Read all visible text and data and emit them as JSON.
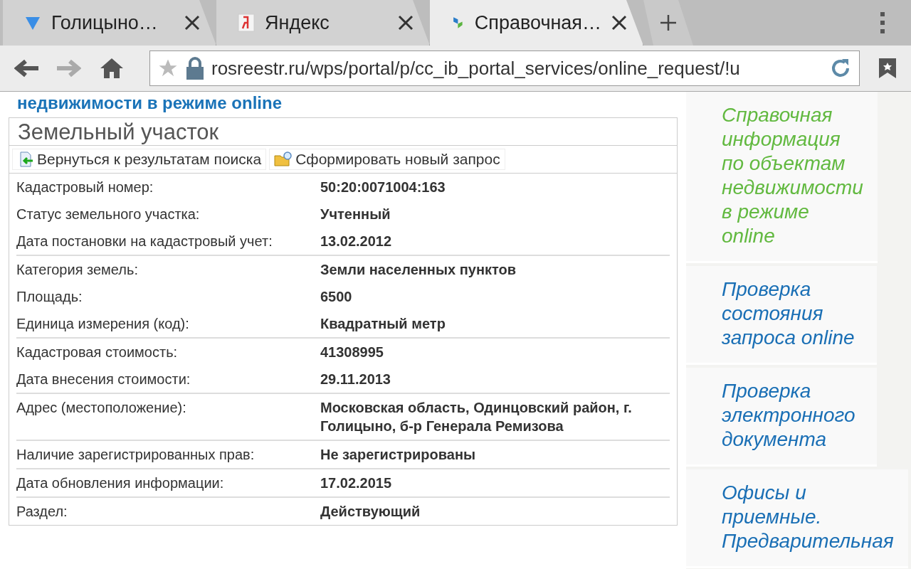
{
  "tabs": [
    {
      "title": "Голицыно…",
      "kind": "check",
      "selected": false
    },
    {
      "title": "Яндекс",
      "kind": "yandex",
      "selected": false
    },
    {
      "title": "Справочная…",
      "kind": "rosreestr",
      "selected": true
    }
  ],
  "address_bar": {
    "url": "rosreestr.ru/wps/portal/p/cc_ib_portal_services/online_request/!u"
  },
  "page_heading": "недвижимости в режиме online",
  "card": {
    "title": "Земельный участок",
    "actions": [
      {
        "label": "Вернуться к результатам поиска",
        "kind": "back"
      },
      {
        "label": "Сформировать новый запрос",
        "kind": "new"
      }
    ],
    "groups": [
      [
        {
          "label": "Кадастровый номер:",
          "value": "50:20:0071004:163"
        },
        {
          "label": "Статус земельного участка:",
          "value": "Учтенный"
        },
        {
          "label": "Дата постановки на кадастровый учет:",
          "value": "13.02.2012"
        }
      ],
      [
        {
          "label": "Категория земель:",
          "value": "Земли населенных пунктов"
        },
        {
          "label": "Площадь:",
          "value": "6500"
        },
        {
          "label": "Единица измерения (код):",
          "value": "Квадратный метр"
        }
      ],
      [
        {
          "label": "Кадастровая стоимость:",
          "value": "41308995"
        },
        {
          "label": "Дата внесения стоимости:",
          "value": "29.11.2013"
        }
      ],
      [
        {
          "label": "Адрес (местоположение):",
          "value": "Московская область, Одинцовский район, г. Голицыно, б-р Генерала Ремизова"
        }
      ],
      [
        {
          "label": "Наличие зарегистрированных прав:",
          "value": "Не зарегистрированы"
        }
      ],
      [
        {
          "label": "Дата обновления информации:",
          "value": "17.02.2015"
        }
      ],
      [
        {
          "label": "Раздел:",
          "value": "Действующий"
        }
      ]
    ]
  },
  "sidebar": {
    "items": [
      {
        "label": "Справочная информация по объектам недвижимости в режиме online",
        "selected": true
      },
      {
        "label": "Проверка состояния запроса online",
        "selected": false
      },
      {
        "label": "Проверка электронного документа",
        "selected": false
      },
      {
        "label": "Офисы и приемные. Предварительная",
        "selected": false
      }
    ]
  }
}
